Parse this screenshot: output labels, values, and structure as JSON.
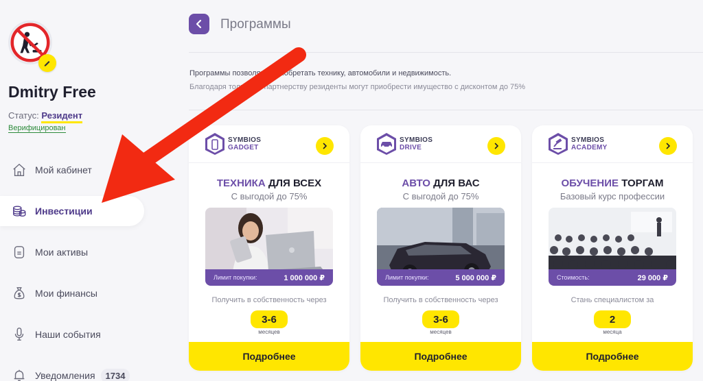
{
  "user": {
    "name": "Dmitry Free",
    "status_label": "Статус:",
    "status_value": "Резидент",
    "verified": "Верифицирован"
  },
  "nav": {
    "items": [
      {
        "label": "Мой кабинет",
        "icon": "home-icon"
      },
      {
        "label": "Инвестиции",
        "icon": "coins-icon",
        "active": true
      },
      {
        "label": "Мои активы",
        "icon": "wallet-icon"
      },
      {
        "label": "Мои финансы",
        "icon": "money-bag-icon"
      },
      {
        "label": "Наши события",
        "icon": "microphone-icon"
      },
      {
        "label": "Уведомления",
        "icon": "bell-icon",
        "badge": "1734"
      }
    ]
  },
  "header": {
    "title": "Программы"
  },
  "intro": {
    "line1": "Программы позволяют приобретать технику, автомобили и недвижимость.",
    "line2": "Благодаря только их партнерству резиденты могут приобрести имущество с дисконтом до 75%"
  },
  "cards": [
    {
      "brand_top": "SYMBIOS",
      "brand_bottom": "GADGET",
      "title_highlight": "ТЕХНИКА",
      "title_rest": " ДЛЯ ВСЕХ",
      "subtitle": "С выгодой до 75%",
      "price_label": "Лимит покупки:",
      "price_value": "1 000 000 ₽",
      "caption": "Получить в собственность через",
      "term": "3-6",
      "term_unit": "месяцев",
      "button": "Подробнее"
    },
    {
      "brand_top": "SYMBIOS",
      "brand_bottom": "DRIVE",
      "title_highlight": "АВТО",
      "title_rest": " ДЛЯ ВАС",
      "subtitle": "С выгодой до 75%",
      "price_label": "Лимит покупки:",
      "price_value": "5 000 000 ₽",
      "caption": "Получить в собственность через",
      "term": "3-6",
      "term_unit": "месяцев",
      "button": "Подробнее"
    },
    {
      "brand_top": "SYMBIOS",
      "brand_bottom": "ACADEMY",
      "title_highlight": "ОБУЧЕНИЕ",
      "title_rest": " ТОРГАМ",
      "subtitle": "Базовый курс профессии",
      "price_label": "Стоимость:",
      "price_value": "29 000 ₽",
      "caption": "Стань специалистом за",
      "term": "2",
      "term_unit": "месяца",
      "button": "Подробнее"
    }
  ],
  "colors": {
    "accent_purple": "#6c4ea8",
    "accent_yellow": "#ffe600",
    "annotation_red": "#f22a12"
  }
}
